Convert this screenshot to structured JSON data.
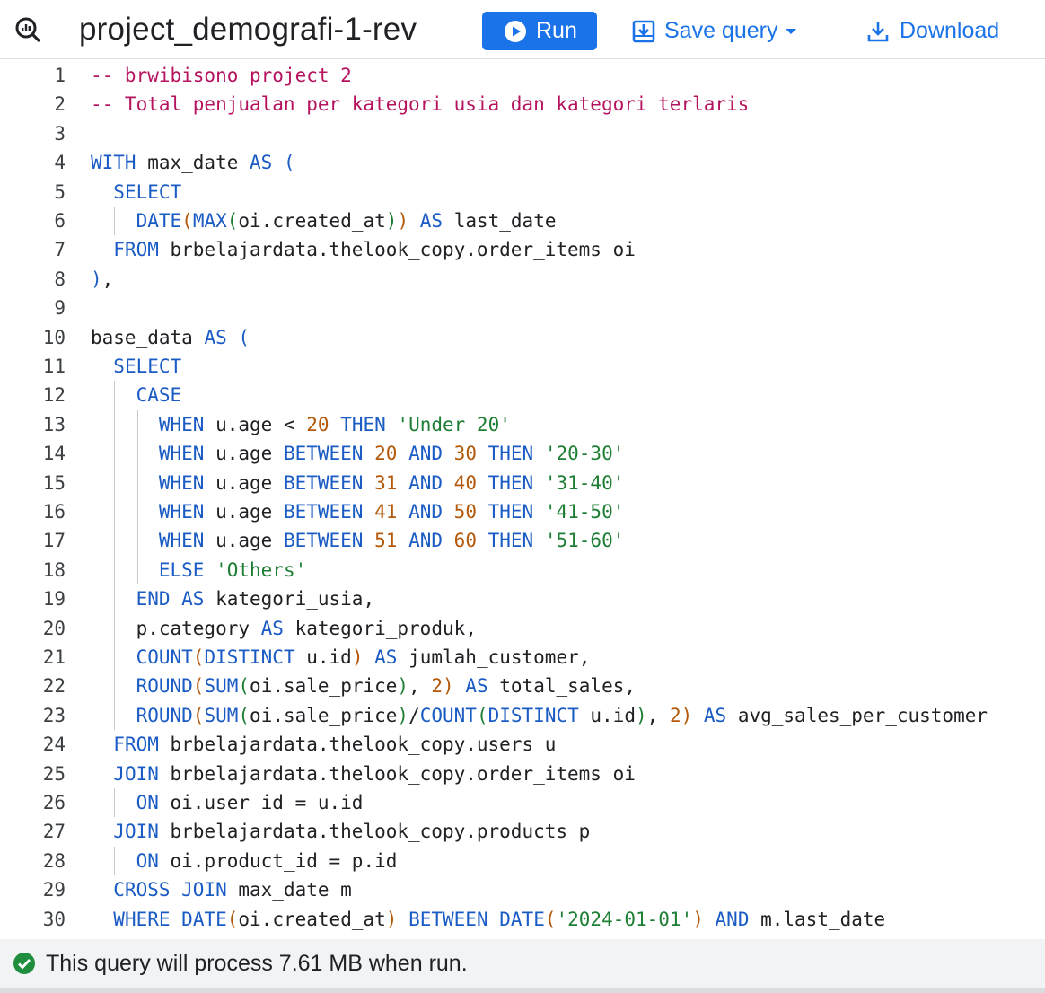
{
  "toolbar": {
    "query_icon": "query-search-icon",
    "title": "project_demografi-1-rev",
    "run_label": "Run",
    "run_icon": "play-circle-icon",
    "save_label": "Save query",
    "save_icon": "save-download-icon",
    "download_label": "Download",
    "download_icon": "download-icon",
    "accent_color": "#1a73e8"
  },
  "editor": {
    "lines": [
      [
        {
          "t": "cm",
          "v": "-- brwibisono project 2"
        }
      ],
      [
        {
          "t": "cm",
          "v": "-- Total penjualan per kategori usia dan kategori terlaris"
        }
      ],
      [],
      [
        {
          "t": "kw",
          "v": "WITH"
        },
        {
          "t": "tx",
          "v": " max_date "
        },
        {
          "t": "kw",
          "v": "AS"
        },
        {
          "t": "tx",
          "v": " "
        },
        {
          "t": "p3",
          "v": "("
        }
      ],
      [
        {
          "t": "tx",
          "v": "  "
        },
        {
          "t": "kw",
          "v": "SELECT"
        }
      ],
      [
        {
          "t": "tx",
          "v": "    "
        },
        {
          "t": "fn",
          "v": "DATE"
        },
        {
          "t": "p1",
          "v": "("
        },
        {
          "t": "fn",
          "v": "MAX"
        },
        {
          "t": "p2",
          "v": "("
        },
        {
          "t": "tx",
          "v": "oi.created_at"
        },
        {
          "t": "p2",
          "v": ")"
        },
        {
          "t": "p1",
          "v": ")"
        },
        {
          "t": "tx",
          "v": " "
        },
        {
          "t": "kw",
          "v": "AS"
        },
        {
          "t": "tx",
          "v": " last_date"
        }
      ],
      [
        {
          "t": "tx",
          "v": "  "
        },
        {
          "t": "kw",
          "v": "FROM"
        },
        {
          "t": "tx",
          "v": " brbelajardata.thelook_copy.order_items oi"
        }
      ],
      [
        {
          "t": "p3",
          "v": ")"
        },
        {
          "t": "tx",
          "v": ","
        }
      ],
      [],
      [
        {
          "t": "tx",
          "v": "base_data "
        },
        {
          "t": "kw",
          "v": "AS"
        },
        {
          "t": "tx",
          "v": " "
        },
        {
          "t": "p3",
          "v": "("
        }
      ],
      [
        {
          "t": "tx",
          "v": "  "
        },
        {
          "t": "kw",
          "v": "SELECT"
        }
      ],
      [
        {
          "t": "tx",
          "v": "    "
        },
        {
          "t": "kw",
          "v": "CASE"
        }
      ],
      [
        {
          "t": "tx",
          "v": "      "
        },
        {
          "t": "kw",
          "v": "WHEN"
        },
        {
          "t": "tx",
          "v": " u.age < "
        },
        {
          "t": "num",
          "v": "20"
        },
        {
          "t": "tx",
          "v": " "
        },
        {
          "t": "kw",
          "v": "THEN"
        },
        {
          "t": "tx",
          "v": " "
        },
        {
          "t": "str",
          "v": "'Under 20'"
        }
      ],
      [
        {
          "t": "tx",
          "v": "      "
        },
        {
          "t": "kw",
          "v": "WHEN"
        },
        {
          "t": "tx",
          "v": " u.age "
        },
        {
          "t": "kw",
          "v": "BETWEEN"
        },
        {
          "t": "tx",
          "v": " "
        },
        {
          "t": "num",
          "v": "20"
        },
        {
          "t": "tx",
          "v": " "
        },
        {
          "t": "kw",
          "v": "AND"
        },
        {
          "t": "tx",
          "v": " "
        },
        {
          "t": "num",
          "v": "30"
        },
        {
          "t": "tx",
          "v": " "
        },
        {
          "t": "kw",
          "v": "THEN"
        },
        {
          "t": "tx",
          "v": " "
        },
        {
          "t": "str",
          "v": "'20-30'"
        }
      ],
      [
        {
          "t": "tx",
          "v": "      "
        },
        {
          "t": "kw",
          "v": "WHEN"
        },
        {
          "t": "tx",
          "v": " u.age "
        },
        {
          "t": "kw",
          "v": "BETWEEN"
        },
        {
          "t": "tx",
          "v": " "
        },
        {
          "t": "num",
          "v": "31"
        },
        {
          "t": "tx",
          "v": " "
        },
        {
          "t": "kw",
          "v": "AND"
        },
        {
          "t": "tx",
          "v": " "
        },
        {
          "t": "num",
          "v": "40"
        },
        {
          "t": "tx",
          "v": " "
        },
        {
          "t": "kw",
          "v": "THEN"
        },
        {
          "t": "tx",
          "v": " "
        },
        {
          "t": "str",
          "v": "'31-40'"
        }
      ],
      [
        {
          "t": "tx",
          "v": "      "
        },
        {
          "t": "kw",
          "v": "WHEN"
        },
        {
          "t": "tx",
          "v": " u.age "
        },
        {
          "t": "kw",
          "v": "BETWEEN"
        },
        {
          "t": "tx",
          "v": " "
        },
        {
          "t": "num",
          "v": "41"
        },
        {
          "t": "tx",
          "v": " "
        },
        {
          "t": "kw",
          "v": "AND"
        },
        {
          "t": "tx",
          "v": " "
        },
        {
          "t": "num",
          "v": "50"
        },
        {
          "t": "tx",
          "v": " "
        },
        {
          "t": "kw",
          "v": "THEN"
        },
        {
          "t": "tx",
          "v": " "
        },
        {
          "t": "str",
          "v": "'41-50'"
        }
      ],
      [
        {
          "t": "tx",
          "v": "      "
        },
        {
          "t": "kw",
          "v": "WHEN"
        },
        {
          "t": "tx",
          "v": " u.age "
        },
        {
          "t": "kw",
          "v": "BETWEEN"
        },
        {
          "t": "tx",
          "v": " "
        },
        {
          "t": "num",
          "v": "51"
        },
        {
          "t": "tx",
          "v": " "
        },
        {
          "t": "kw",
          "v": "AND"
        },
        {
          "t": "tx",
          "v": " "
        },
        {
          "t": "num",
          "v": "60"
        },
        {
          "t": "tx",
          "v": " "
        },
        {
          "t": "kw",
          "v": "THEN"
        },
        {
          "t": "tx",
          "v": " "
        },
        {
          "t": "str",
          "v": "'51-60'"
        }
      ],
      [
        {
          "t": "tx",
          "v": "      "
        },
        {
          "t": "kw",
          "v": "ELSE"
        },
        {
          "t": "tx",
          "v": " "
        },
        {
          "t": "str",
          "v": "'Others'"
        }
      ],
      [
        {
          "t": "tx",
          "v": "    "
        },
        {
          "t": "kw",
          "v": "END AS"
        },
        {
          "t": "tx",
          "v": " kategori_usia,"
        }
      ],
      [
        {
          "t": "tx",
          "v": "    p.category "
        },
        {
          "t": "kw",
          "v": "AS"
        },
        {
          "t": "tx",
          "v": " kategori_produk,"
        }
      ],
      [
        {
          "t": "tx",
          "v": "    "
        },
        {
          "t": "fn",
          "v": "COUNT"
        },
        {
          "t": "p1",
          "v": "("
        },
        {
          "t": "kw",
          "v": "DISTINCT"
        },
        {
          "t": "tx",
          "v": " u.id"
        },
        {
          "t": "p1",
          "v": ")"
        },
        {
          "t": "tx",
          "v": " "
        },
        {
          "t": "kw",
          "v": "AS"
        },
        {
          "t": "tx",
          "v": " jumlah_customer,"
        }
      ],
      [
        {
          "t": "tx",
          "v": "    "
        },
        {
          "t": "fn",
          "v": "ROUND"
        },
        {
          "t": "p1",
          "v": "("
        },
        {
          "t": "fn",
          "v": "SUM"
        },
        {
          "t": "p2",
          "v": "("
        },
        {
          "t": "tx",
          "v": "oi.sale_price"
        },
        {
          "t": "p2",
          "v": ")"
        },
        {
          "t": "tx",
          "v": ", "
        },
        {
          "t": "num",
          "v": "2"
        },
        {
          "t": "p1",
          "v": ")"
        },
        {
          "t": "tx",
          "v": " "
        },
        {
          "t": "kw",
          "v": "AS"
        },
        {
          "t": "tx",
          "v": " total_sales,"
        }
      ],
      [
        {
          "t": "tx",
          "v": "    "
        },
        {
          "t": "fn",
          "v": "ROUND"
        },
        {
          "t": "p1",
          "v": "("
        },
        {
          "t": "fn",
          "v": "SUM"
        },
        {
          "t": "p2",
          "v": "("
        },
        {
          "t": "tx",
          "v": "oi.sale_price"
        },
        {
          "t": "p2",
          "v": ")"
        },
        {
          "t": "tx",
          "v": "/"
        },
        {
          "t": "fn",
          "v": "COUNT"
        },
        {
          "t": "p2",
          "v": "("
        },
        {
          "t": "kw",
          "v": "DISTINCT"
        },
        {
          "t": "tx",
          "v": " u.id"
        },
        {
          "t": "p2",
          "v": ")"
        },
        {
          "t": "tx",
          "v": ", "
        },
        {
          "t": "num",
          "v": "2"
        },
        {
          "t": "p1",
          "v": ")"
        },
        {
          "t": "tx",
          "v": " "
        },
        {
          "t": "kw",
          "v": "AS"
        },
        {
          "t": "tx",
          "v": " avg_sales_per_customer"
        }
      ],
      [
        {
          "t": "tx",
          "v": "  "
        },
        {
          "t": "kw",
          "v": "FROM"
        },
        {
          "t": "tx",
          "v": " brbelajardata.thelook_copy.users u"
        }
      ],
      [
        {
          "t": "tx",
          "v": "  "
        },
        {
          "t": "kw",
          "v": "JOIN"
        },
        {
          "t": "tx",
          "v": " brbelajardata.thelook_copy.order_items oi"
        }
      ],
      [
        {
          "t": "tx",
          "v": "    "
        },
        {
          "t": "kw",
          "v": "ON"
        },
        {
          "t": "tx",
          "v": " oi.user_id = u.id"
        }
      ],
      [
        {
          "t": "tx",
          "v": "  "
        },
        {
          "t": "kw",
          "v": "JOIN"
        },
        {
          "t": "tx",
          "v": " brbelajardata.thelook_copy.products p"
        }
      ],
      [
        {
          "t": "tx",
          "v": "    "
        },
        {
          "t": "kw",
          "v": "ON"
        },
        {
          "t": "tx",
          "v": " oi.product_id = p.id"
        }
      ],
      [
        {
          "t": "tx",
          "v": "  "
        },
        {
          "t": "kw",
          "v": "CROSS JOIN"
        },
        {
          "t": "tx",
          "v": " max_date m"
        }
      ],
      [
        {
          "t": "tx",
          "v": "  "
        },
        {
          "t": "kw",
          "v": "WHERE"
        },
        {
          "t": "tx",
          "v": " "
        },
        {
          "t": "fn",
          "v": "DATE"
        },
        {
          "t": "p1",
          "v": "("
        },
        {
          "t": "tx",
          "v": "oi.created_at"
        },
        {
          "t": "p1",
          "v": ")"
        },
        {
          "t": "tx",
          "v": " "
        },
        {
          "t": "kw",
          "v": "BETWEEN"
        },
        {
          "t": "tx",
          "v": " "
        },
        {
          "t": "fn",
          "v": "DATE"
        },
        {
          "t": "p1",
          "v": "("
        },
        {
          "t": "str",
          "v": "'2024-01-01'"
        },
        {
          "t": "p1",
          "v": ")"
        },
        {
          "t": "tx",
          "v": " "
        },
        {
          "t": "kw",
          "v": "AND"
        },
        {
          "t": "tx",
          "v": " m.last_date"
        }
      ]
    ],
    "colors": {
      "keyword": "#1a5bc4",
      "comment": "#b5135e",
      "string": "#1e7e34",
      "number": "#b4580a"
    }
  },
  "status": {
    "icon": "check-circle-icon",
    "text": "This query will process 7.61 MB when run.",
    "color": "#1e8e3e"
  }
}
